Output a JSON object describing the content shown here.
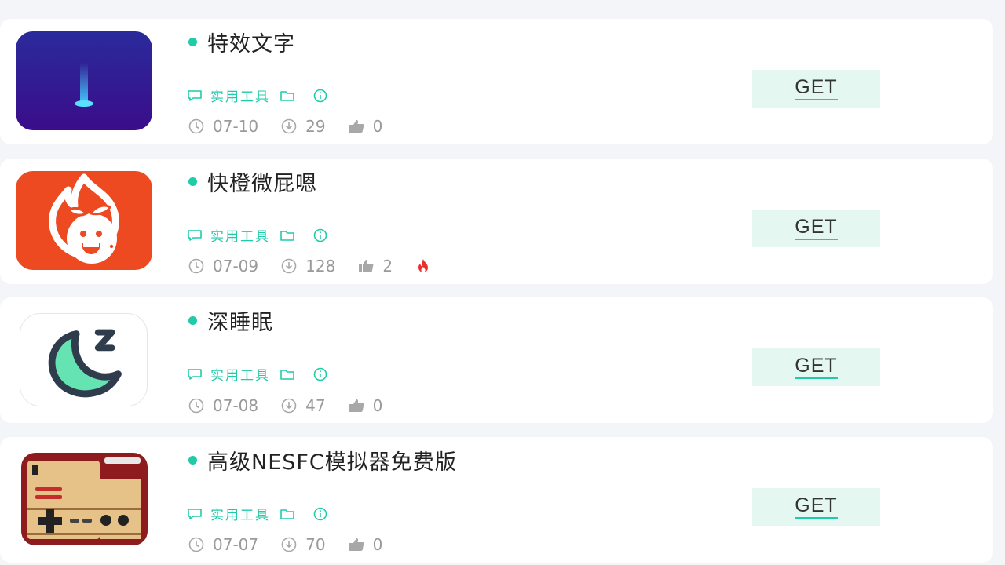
{
  "apps": [
    {
      "name": "特效文字",
      "category": "实用工具",
      "date": "07-10",
      "downloads": "29",
      "likes": "0",
      "hot": false,
      "icon": "light-beam-app-icon"
    },
    {
      "name": "快橙微屁嗯",
      "category": "实用工具",
      "date": "07-09",
      "downloads": "128",
      "likes": "2",
      "hot": true,
      "icon": "flame-orange-app-icon"
    },
    {
      "name": "深睡眠",
      "category": "实用工具",
      "date": "07-08",
      "downloads": "47",
      "likes": "0",
      "hot": false,
      "icon": "moon-sleep-app-icon"
    },
    {
      "name": "高级NESFC模拟器免费版",
      "category": "实用工具",
      "date": "07-07",
      "downloads": "70",
      "likes": "0",
      "hot": false,
      "icon": "retro-console-app-icon"
    }
  ],
  "get_label": "GET",
  "colors": {
    "accent": "#1fcba8",
    "button_bg": "#e4f8f1",
    "page_bg": "#f4f5f9",
    "hot": "#ee2d2d"
  }
}
